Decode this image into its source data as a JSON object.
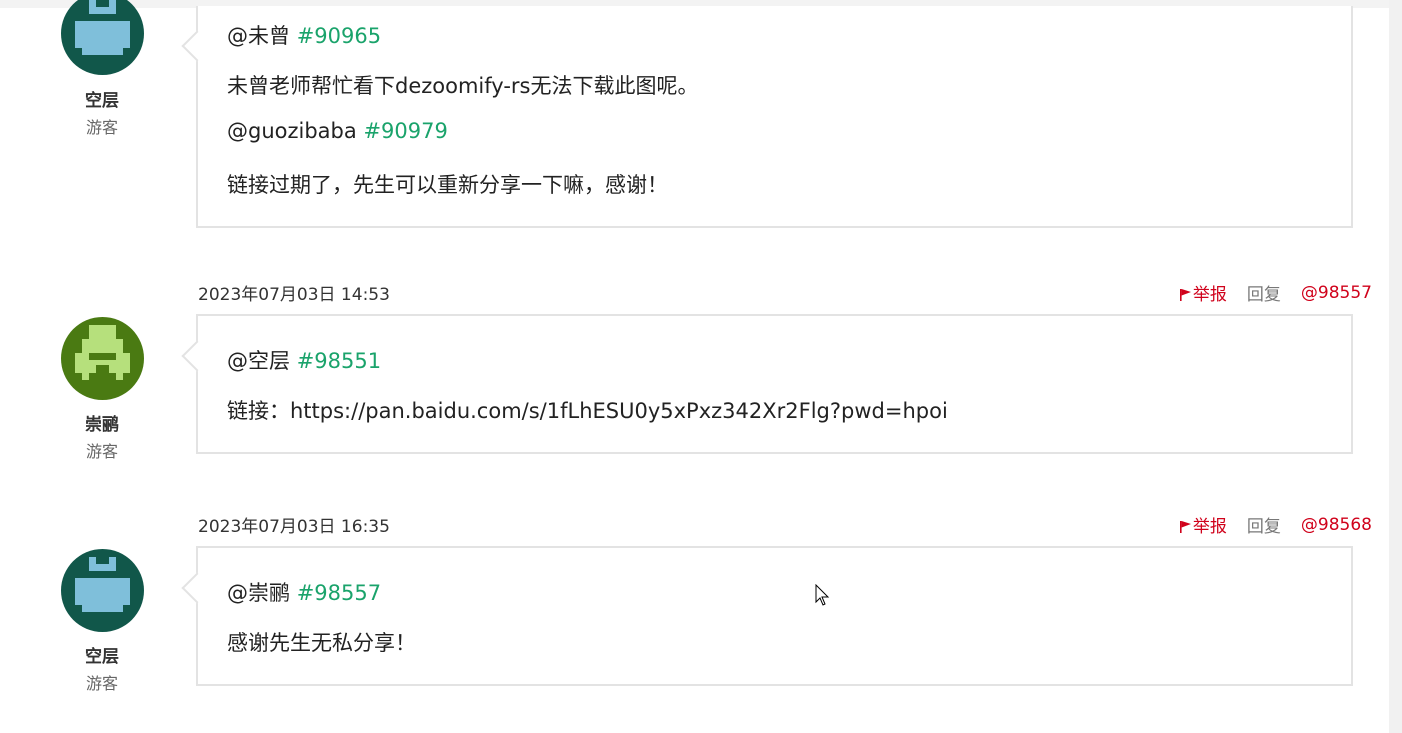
{
  "comments": [
    {
      "author": "空层",
      "role": "游客",
      "avatar_icon": "pixel-avatar-teal",
      "lines": [
        {
          "mention": "@未曾",
          "ref": "#90965"
        },
        {
          "text": "未曾老师帮忙看下dezoomify-rs无法下载此图呢。"
        },
        {
          "mention": "@guozibaba",
          "ref": "#90979"
        },
        {
          "text": "链接过期了，先生可以重新分享一下嘛，感谢！"
        }
      ]
    },
    {
      "timestamp": "2023年07月03日 14:53",
      "report_label": "举报",
      "reply_label": "回复",
      "comment_id": "@98557",
      "author": "崇鹂",
      "role": "游客",
      "avatar_icon": "pixel-avatar-green",
      "lines": [
        {
          "mention": "@空层",
          "ref": "#98551"
        },
        {
          "text": "链接：https://pan.baidu.com/s/1fLhESU0y5xPxz342Xr2Flg?pwd=hpoi"
        }
      ]
    },
    {
      "timestamp": "2023年07月03日 16:35",
      "report_label": "举报",
      "reply_label": "回复",
      "comment_id": "@98568",
      "author": "空层",
      "role": "游客",
      "avatar_icon": "pixel-avatar-teal",
      "lines": [
        {
          "mention": "@崇鹂",
          "ref": "#98557"
        },
        {
          "text": "感谢先生无私分享！"
        }
      ]
    }
  ],
  "colors": {
    "accent_ref": "#1aa36b",
    "report_red": "#d0021b",
    "border": "#e3e3e3"
  }
}
